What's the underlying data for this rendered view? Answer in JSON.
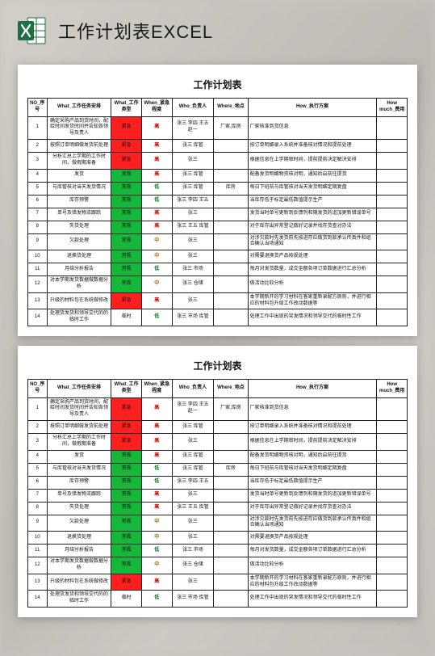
{
  "page_title": "工作计划表EXCEL",
  "sheet_title": "工作计划表",
  "columns": {
    "no": "NO_序号",
    "task": "What_工作任务安排",
    "type": "What_工作类型",
    "urg": "When_紧急程度",
    "who": "Who_负责人",
    "where": "Where_地点",
    "how": "How_执行方案",
    "cost": "How much_费用"
  },
  "type_labels": {
    "red": "紧急",
    "green": "常规",
    "temp": "临时"
  },
  "urgency_labels": {
    "high": "高",
    "mid": "中",
    "low": "低"
  },
  "rows": [
    {
      "no": 1,
      "task": "确定采购产品到货时间，配给时间发货时间并告知各领导及责人",
      "type": "red",
      "urg": "high",
      "who": "张三 李四 王五 赵一",
      "where": "厂家,库房",
      "how": "厂家核准到货信息"
    },
    {
      "no": 2,
      "task": "按照订单明细做发货前处理",
      "type": "red",
      "urg": "high",
      "who": "张三 库管",
      "where": "",
      "how": "按订单明细录入系统并准备核对情况和提前处理"
    },
    {
      "no": 3,
      "task": "分析汇总上学期的工作时间，做假期准备",
      "type": "red",
      "urg": "high",
      "who": "张三",
      "where": "",
      "how": "根据信息在上学期审时间，提前提前决定解决安排"
    },
    {
      "no": 4,
      "task": "发货",
      "type": "green",
      "urg": "high",
      "who": "张三 库管",
      "where": "",
      "how": "配备发货明细物资核对明，通知后启前往提货"
    },
    {
      "no": 5,
      "task": "与库管核对当天发货情况",
      "type": "green",
      "urg": "low",
      "who": "张三 库管",
      "where": "库房",
      "how": "每日下班前与库管核对当天发货明细定期复盘"
    },
    {
      "no": 6,
      "task": "库存预警",
      "type": "green",
      "urg": "low",
      "who": "张三 李四 王五",
      "where": "",
      "how": "当库存低于标定最低数值提示生产"
    },
    {
      "no": 7,
      "task": "单号及错发物流跟踪",
      "type": "green",
      "urg": "high",
      "who": "张三",
      "where": "",
      "how": "发货当时单号更新到反馈列和随发货的追加更新错误单号"
    },
    {
      "no": 8,
      "task": "失货处理",
      "type": "green",
      "urg": "high",
      "who": "张三 王五 库管",
      "where": "",
      "how": "对于库存出异常登记做好记录并找存货查对办法"
    },
    {
      "no": 9,
      "task": "欠款处理",
      "type": "green",
      "urg": "mid",
      "who": "张三",
      "where": "",
      "how": "对涉欠款时先发货前先按进存应做货到款承认传真件和组合确认当场通知"
    },
    {
      "no": 10,
      "task": "退换货处理",
      "type": "green",
      "urg": "mid",
      "who": "张三",
      "where": "",
      "how": "对需要退换货产品按规处理"
    },
    {
      "no": 11,
      "task": "月结分析报告",
      "type": "green",
      "urg": "low",
      "who": "张三 市场",
      "where": "",
      "how": "每月对发货数量，成交金额各项订单数据进行汇总分析"
    },
    {
      "no": 12,
      "task": "对本学期发货数据做数据分析",
      "type": "green",
      "urg": "mid",
      "who": "张三 仓储",
      "where": "",
      "how": "做活动比较分析"
    },
    {
      "no": 13,
      "task": "升级的材料包在系统做修改",
      "type": "red",
      "urg": "high",
      "who": "张三",
      "where": "",
      "how": "本学期新开的学习材料在客家重新录配方原则，并进行相应的材料包升级工作改动数据等"
    },
    {
      "no": 14,
      "task": "处理货发货和领导交代的的临时工作",
      "type": "temp",
      "urg": "low",
      "who": "张三 市场 库管",
      "where": "",
      "how": "处理工作中出现的突发情况和领导交代的临时性工作"
    }
  ]
}
